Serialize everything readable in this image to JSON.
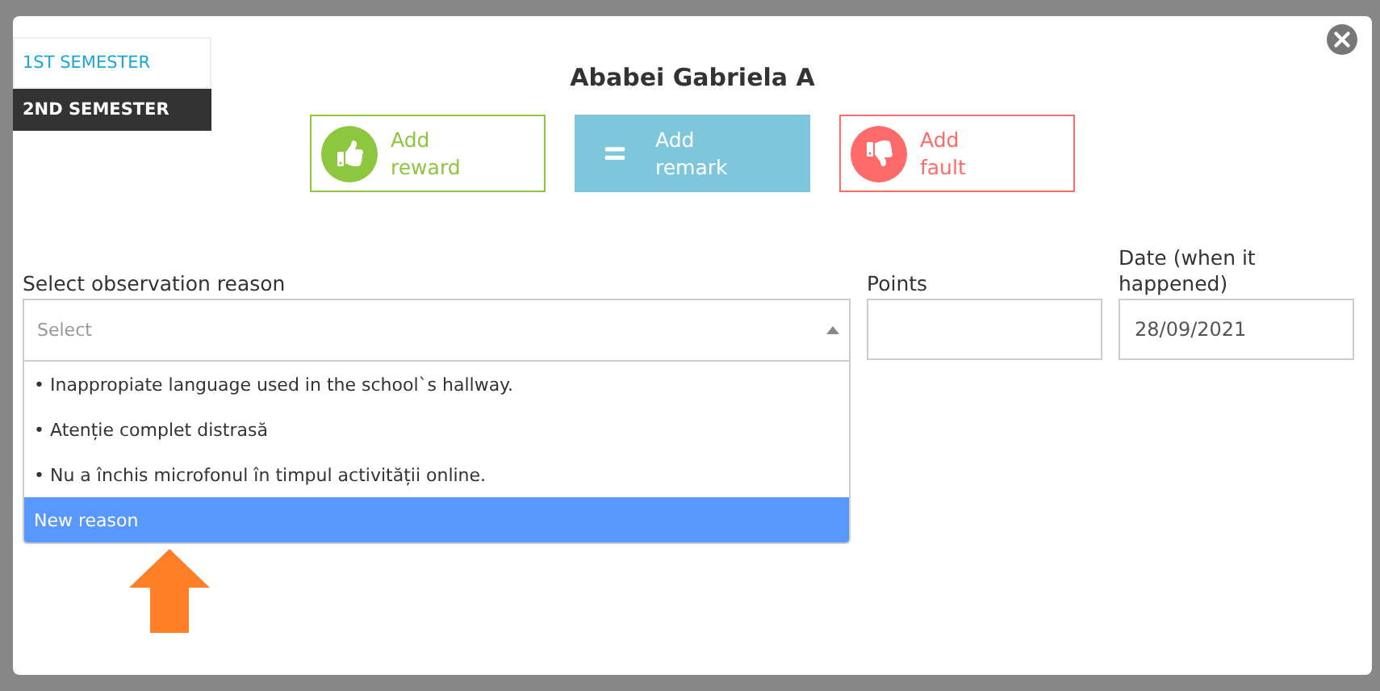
{
  "semester_tabs": [
    {
      "label": "1ST SEMESTER",
      "selected": false
    },
    {
      "label": "2ND SEMESTER",
      "selected": true
    }
  ],
  "title": "Ababei Gabriela A",
  "actions": [
    {
      "kind": "reward",
      "line1": "Add",
      "line2": "reward"
    },
    {
      "kind": "remark",
      "line1": "Add",
      "line2": "remark"
    },
    {
      "kind": "fault",
      "line1": "Add",
      "line2": "fault"
    }
  ],
  "reason": {
    "label": "Select observation reason",
    "placeholder": "Select",
    "expanded": true,
    "options": [
      {
        "label": "• Inappropiate language used in the school`s hallway.",
        "selected": false
      },
      {
        "label": "• Atenție complet distrasă",
        "selected": false
      },
      {
        "label": "• Nu a închis microfonul în timpul activității online.",
        "selected": false
      },
      {
        "label": "New reason",
        "selected": true
      }
    ]
  },
  "points": {
    "label": "Points"
  },
  "date": {
    "label": "Date (when it happened)",
    "value": "28/09/2021"
  }
}
